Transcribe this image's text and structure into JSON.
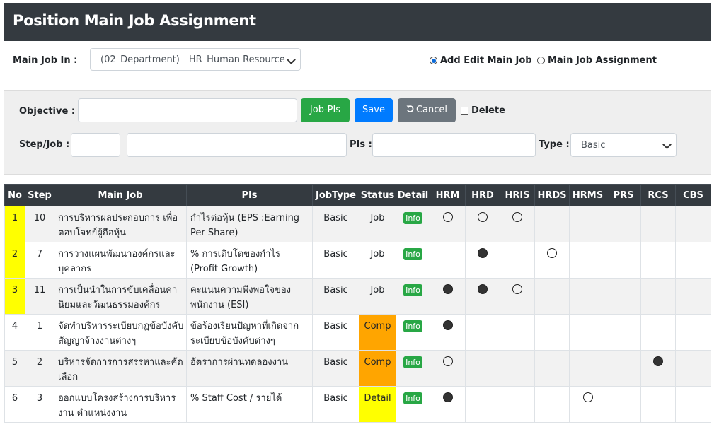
{
  "title": "Position Main Job Assignment",
  "top": {
    "main_job_label": "Main Job In :",
    "main_job_value": "(02_Department)__HR_Human Resource",
    "radio_add_label": "Add Edit Main Job",
    "radio_assign_label": "Main Job Assignment",
    "radio_selected": "add"
  },
  "form": {
    "objective_label": "Objective :",
    "objective_value": "",
    "jobpis_label": "Job-PIs",
    "save_label": "Save",
    "cancel_label": "Cancel",
    "delete_label": "Delete",
    "stepjob_label": "Step/Job :",
    "step_value": "",
    "job_value": "",
    "pis_label": "PIs :",
    "pis_value": "",
    "type_label": "Type :",
    "type_value": "Basic"
  },
  "colors": {
    "header_bg": "#343a40",
    "info_green": "#28a745",
    "save_blue": "#007bff",
    "cancel_grey": "#6c757d",
    "highlight_yellow": "#ffff00",
    "comp_orange": "#ffa500"
  },
  "table": {
    "headers": [
      "No",
      "Step",
      "Main Job",
      "PIs",
      "JobType",
      "Status",
      "Detail",
      "HRM",
      "HRD",
      "HRIS",
      "HRDS",
      "HRMS",
      "PRS",
      "RCS",
      "CBS"
    ],
    "info_label": "Info",
    "rows": [
      {
        "no": "1",
        "step": "10",
        "main_job": "การบริหารผลประกอบการ เพื่อตอบโจทย์ผู้ถือหุ้น",
        "pis": "กำไรต่อหุ้น (EPS :Earning Per Share)",
        "job_type": "Basic",
        "status": "Job",
        "highlight": true,
        "marks": {
          "HRM": "open",
          "HRD": "open",
          "HRIS": "open"
        }
      },
      {
        "no": "2",
        "step": "7",
        "main_job": "การวางแผนพัฒนาองค์กรและบุคลากร",
        "pis": "% การเติบโตของกำไร (Profit Growth)",
        "job_type": "Basic",
        "status": "Job",
        "highlight": true,
        "marks": {
          "HRD": "filled",
          "HRDS": "open"
        }
      },
      {
        "no": "3",
        "step": "11",
        "main_job": "การเป็นนำในการขับเคลื่อนค่านิยมและวัฒนธรรมองค์กร",
        "pis": "คะแนนความพึงพอใจของพนักงาน (ESI)",
        "job_type": "Basic",
        "status": "Job",
        "highlight": true,
        "marks": {
          "HRM": "filled",
          "HRD": "filled",
          "HRIS": "open"
        }
      },
      {
        "no": "4",
        "step": "1",
        "main_job": "จัดทำบริหารระเบียบกฎข้อบังคับสัญญาจ้างงานต่างๆ",
        "pis": "ข้อร้องเรียนปัญหาที่เกิดจากระเบียบข้อบังคับต่างๆ",
        "job_type": "Basic",
        "status": "Comp",
        "highlight": false,
        "marks": {
          "HRM": "filled"
        }
      },
      {
        "no": "5",
        "step": "2",
        "main_job": "บริหารจัดการการสรรหาและคัดเลือก",
        "pis": "อัตราการผ่านทดลองงาน",
        "job_type": "Basic",
        "status": "Comp",
        "highlight": false,
        "marks": {
          "HRM": "open",
          "RCS": "filled"
        }
      },
      {
        "no": "6",
        "step": "3",
        "main_job": "ออกแบบโครงสร้างการบริหารงาน ตำแหน่งงาน",
        "pis": "% Staff Cost / รายได้",
        "job_type": "Basic",
        "status": "Detail",
        "highlight": false,
        "marks": {
          "HRM": "filled",
          "HRMS": "open"
        }
      }
    ]
  }
}
